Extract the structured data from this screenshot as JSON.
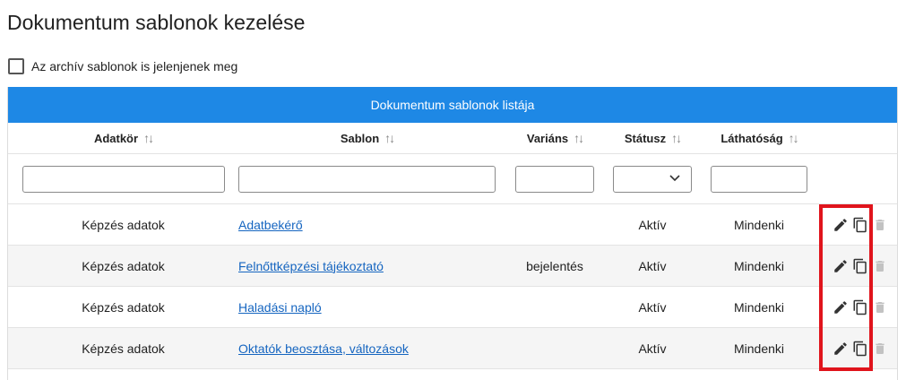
{
  "page": {
    "title": "Dokumentum sablonok kezelése"
  },
  "archive_filter": {
    "label": "Az archív sablonok is jelenjenek meg",
    "checked": false
  },
  "table": {
    "caption": "Dokumentum sablonok listája",
    "columns": [
      "Adatkör",
      "Sablon",
      "Variáns",
      "Státusz",
      "Láthatóság"
    ],
    "sort_icon": "sort-icon",
    "rows": [
      {
        "adatkor": "Képzés adatok",
        "sablon": "Adatbekérő",
        "varians": "",
        "statusz": "Aktív",
        "lathatosag": "Mindenki"
      },
      {
        "adatkor": "Képzés adatok",
        "sablon": "Felnőttképzési tájékoztató",
        "varians": "bejelentés",
        "statusz": "Aktív",
        "lathatosag": "Mindenki"
      },
      {
        "adatkor": "Képzés adatok",
        "sablon": "Haladási napló",
        "varians": "",
        "statusz": "Aktív",
        "lathatosag": "Mindenki"
      },
      {
        "adatkor": "Képzés adatok",
        "sablon": "Oktatók beosztása, változások",
        "varians": "",
        "statusz": "Aktív",
        "lathatosag": "Mindenki"
      }
    ],
    "row_actions": [
      "edit-icon",
      "copy-icon",
      "delete-icon"
    ]
  },
  "colors": {
    "header": "#1e88e5",
    "link": "#1565c0",
    "highlight": "#e0141c",
    "row_alt": "#f5f5f5"
  }
}
